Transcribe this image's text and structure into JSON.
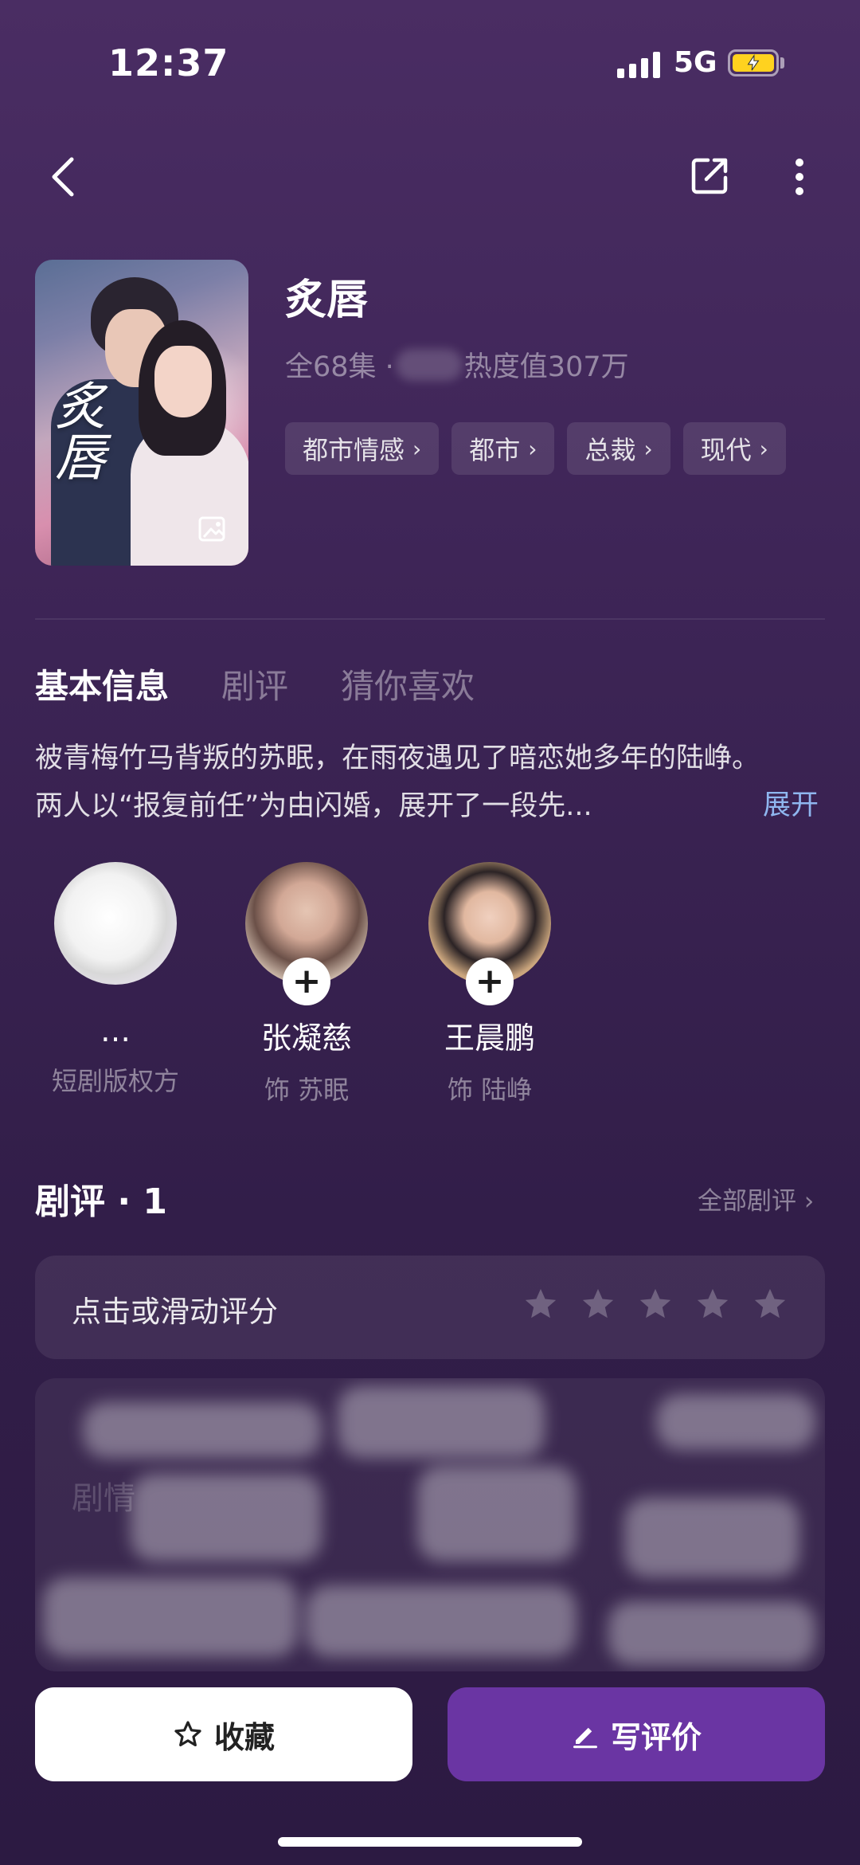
{
  "status_bar": {
    "time": "12:37",
    "network": "5G"
  },
  "drama": {
    "title": "炙唇",
    "episodes": "全68集 ·",
    "heat": "热度值307万",
    "tags": [
      "都市情感",
      "都市",
      "总裁",
      "现代"
    ]
  },
  "tabs": [
    "基本信息",
    "剧评",
    "猜你喜欢"
  ],
  "synopsis": {
    "text": "被青梅竹马背叛的苏眠，在雨夜遇见了暗恋她多年的陆峥。两人以“报复前任”为由闪婚，展开了一段先...",
    "expand_label": "展开"
  },
  "cast": [
    {
      "name": "…",
      "role": "短剧版权方",
      "avatar": "blurred-avatar",
      "followable": false
    },
    {
      "name": "张凝慈",
      "role": "饰 苏眠",
      "avatar": "actress-avatar",
      "followable": true
    },
    {
      "name": "王晨鹏",
      "role": "饰 陆峥",
      "avatar": "actor-avatar",
      "followable": true
    }
  ],
  "reviews": {
    "heading": "剧评 · 1",
    "all_label": "全部剧评 ›",
    "rate_prompt": "点击或滑动评分",
    "star_count": 5,
    "redacted_text": "剧情"
  },
  "actions": {
    "favorite_label": "收藏",
    "write_review_label": "写评价"
  },
  "colors": {
    "background_top": "#4a2d63",
    "background_bottom": "#2c1a42",
    "accent_button": "#6a35a3",
    "link_blue": "#8fb6ef",
    "battery_yellow": "#ffd21f"
  },
  "icons": [
    "back-arrow-icon",
    "share-icon",
    "more-vertical-icon",
    "image-icon",
    "plus-icon",
    "star-icon",
    "edit-icon",
    "chevron-right-icon"
  ]
}
